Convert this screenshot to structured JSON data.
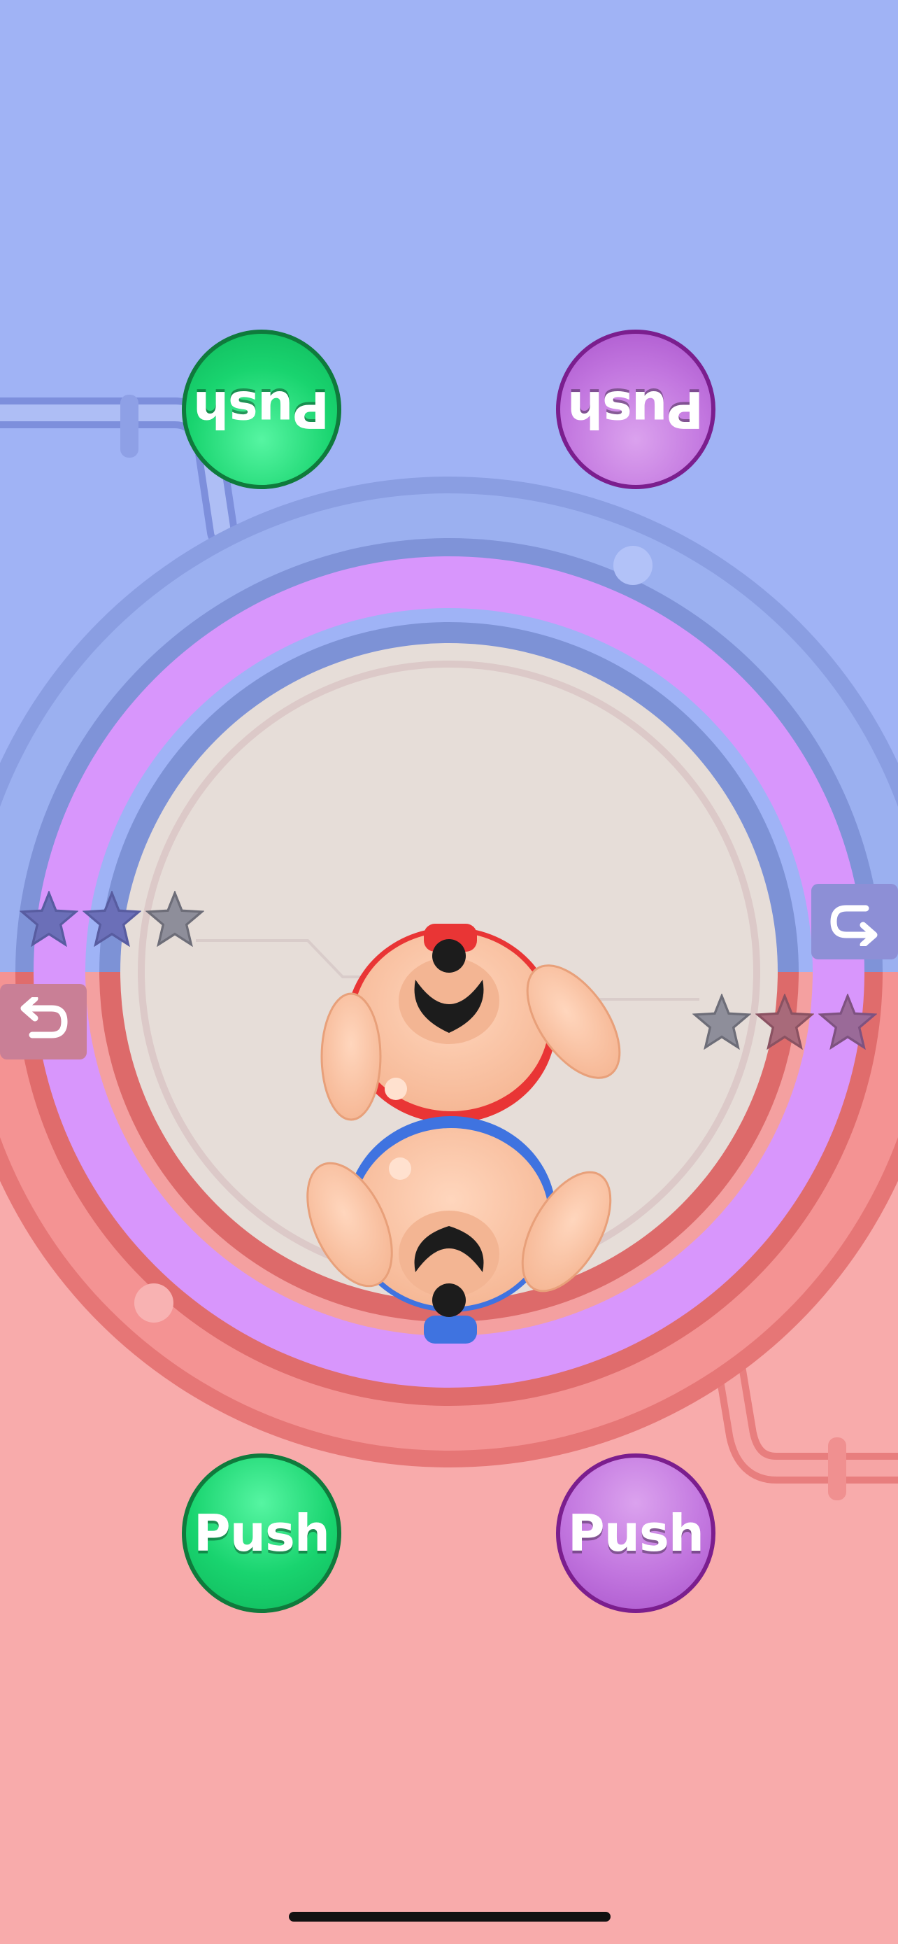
{
  "colors": {
    "top_background": "#a0b3f5",
    "bottom_background": "#f8abab",
    "ring_purple": "#d896fc",
    "arena_floor": "#e6ddd8",
    "green_button": "#19d46f",
    "purple_button": "#c276df",
    "top_wrestler_belt": "#e93535",
    "bottom_wrestler_belt": "#3f73e0"
  },
  "top_player": {
    "push_green_label": "Push",
    "push_purple_label": "Push",
    "control_icon": "undo-arrow-icon",
    "stars_earned": 2,
    "stars_total": 3
  },
  "bottom_player": {
    "push_green_label": "Push",
    "push_purple_label": "Push",
    "control_icon": "undo-arrow-icon",
    "stars_earned": 2,
    "stars_total": 3
  }
}
